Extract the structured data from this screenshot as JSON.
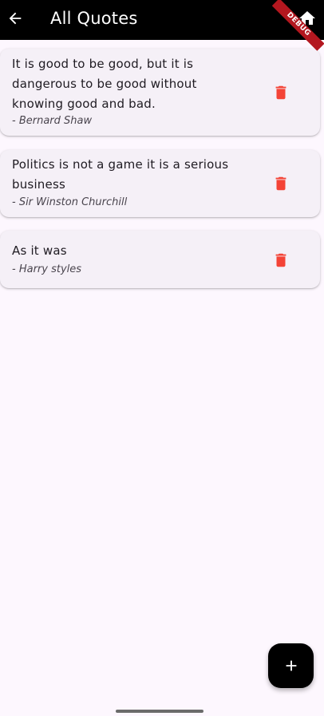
{
  "appbar": {
    "title": "All Quotes",
    "back_icon": "arrow-back-icon",
    "home_icon": "home-icon",
    "debug_label": "DEBUG"
  },
  "quotes": [
    {
      "text": "It is good to be good, but it is dangerous to be good without knowing good and bad.",
      "author": "- Bernard Shaw"
    },
    {
      "text": "Politics is not a game it is a serious business",
      "author": "- Sir Winston Churchill"
    },
    {
      "text": "As it was",
      "author": "- Harry styles"
    }
  ],
  "fab": {
    "icon": "plus-icon"
  },
  "colors": {
    "appbar": "#000000",
    "background": "#fdf7fe",
    "card": "#f5f0f7",
    "delete": "#f44336",
    "fab": "#000000"
  }
}
